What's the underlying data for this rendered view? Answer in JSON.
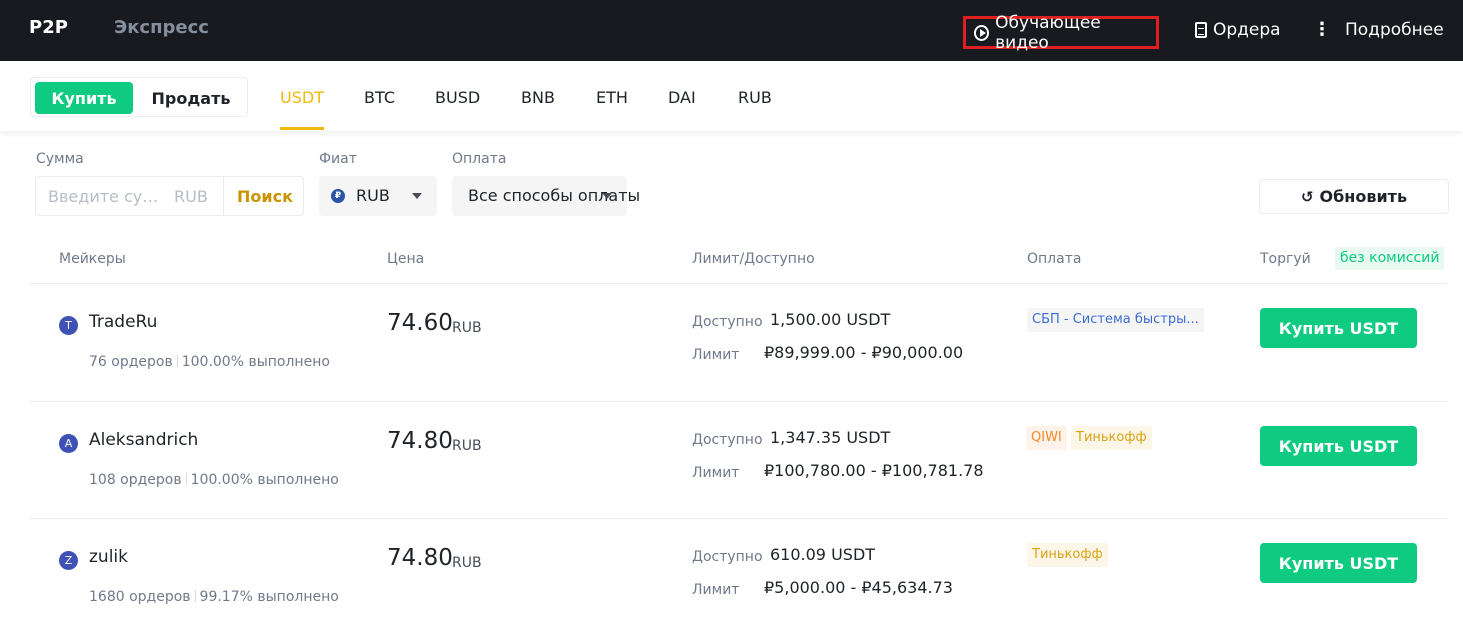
{
  "topbar": {
    "tab_p2p": "P2P",
    "tab_express": "Экспресс",
    "video_link": "Обучающее видео",
    "orders_link": "Ордера",
    "more_link": "Подробнее"
  },
  "subbar": {
    "buy": "Купить",
    "sell": "Продать",
    "coins": [
      "USDT",
      "BTC",
      "BUSD",
      "BNB",
      "ETH",
      "DAI",
      "RUB"
    ],
    "active_coin": "USDT"
  },
  "filters": {
    "amount_label": "Сумма",
    "amount_placeholder": "Введите сумму",
    "amount_currency": "RUB",
    "search_button": "Поиск",
    "fiat_label": "Фиат",
    "fiat_icon_glyph": "₽",
    "fiat_value": "RUB",
    "payment_label": "Оплата",
    "payment_value": "Все способы оплаты",
    "refresh_button": "Обновить"
  },
  "table": {
    "headers": {
      "makers": "Мейкеры",
      "price": "Цена",
      "limit": "Лимит/Доступно",
      "payment": "Оплата",
      "trade": "Торгуй",
      "no_commission": "без комиссий"
    },
    "available_label": "Доступно",
    "limit_label": "Лимит",
    "rows": [
      {
        "avatar_letter": "T",
        "name": "TradeRu",
        "orders": "76 ордеров",
        "completion": "100.00% выполнено",
        "price": "74.60",
        "price_currency": "RUB",
        "available": "1,500.00 USDT",
        "limit": "₽89,999.00 - ₽90,000.00",
        "payments": [
          {
            "label": "СБП - Система быстры...",
            "color": "#3c6dd4"
          }
        ],
        "button": "Купить USDT"
      },
      {
        "avatar_letter": "A",
        "name": "Aleksandrich",
        "orders": "108 ордеров",
        "completion": "100.00% выполнено",
        "price": "74.80",
        "price_currency": "RUB",
        "available": "1,347.35 USDT",
        "limit": "₽100,780.00 - ₽100,781.78",
        "payments": [
          {
            "label": "QIWI",
            "color": "#f08a24"
          },
          {
            "label": "Тинькофф",
            "color": "#d8a414"
          }
        ],
        "button": "Купить USDT"
      },
      {
        "avatar_letter": "Z",
        "name": "zulik",
        "orders": "1680 ордеров",
        "completion": "99.17% выполнено",
        "price": "74.80",
        "price_currency": "RUB",
        "available": "610.09 USDT",
        "limit": "₽5,000.00 - ₽45,634.73",
        "payments": [
          {
            "label": "Тинькофф",
            "color": "#d8a414"
          }
        ],
        "button": "Купить USDT"
      }
    ]
  },
  "colors": {
    "accent_green": "#0ecb81",
    "accent_yellow": "#f0b90b",
    "topbar_bg": "#181a20",
    "highlight_border": "#e02020"
  }
}
